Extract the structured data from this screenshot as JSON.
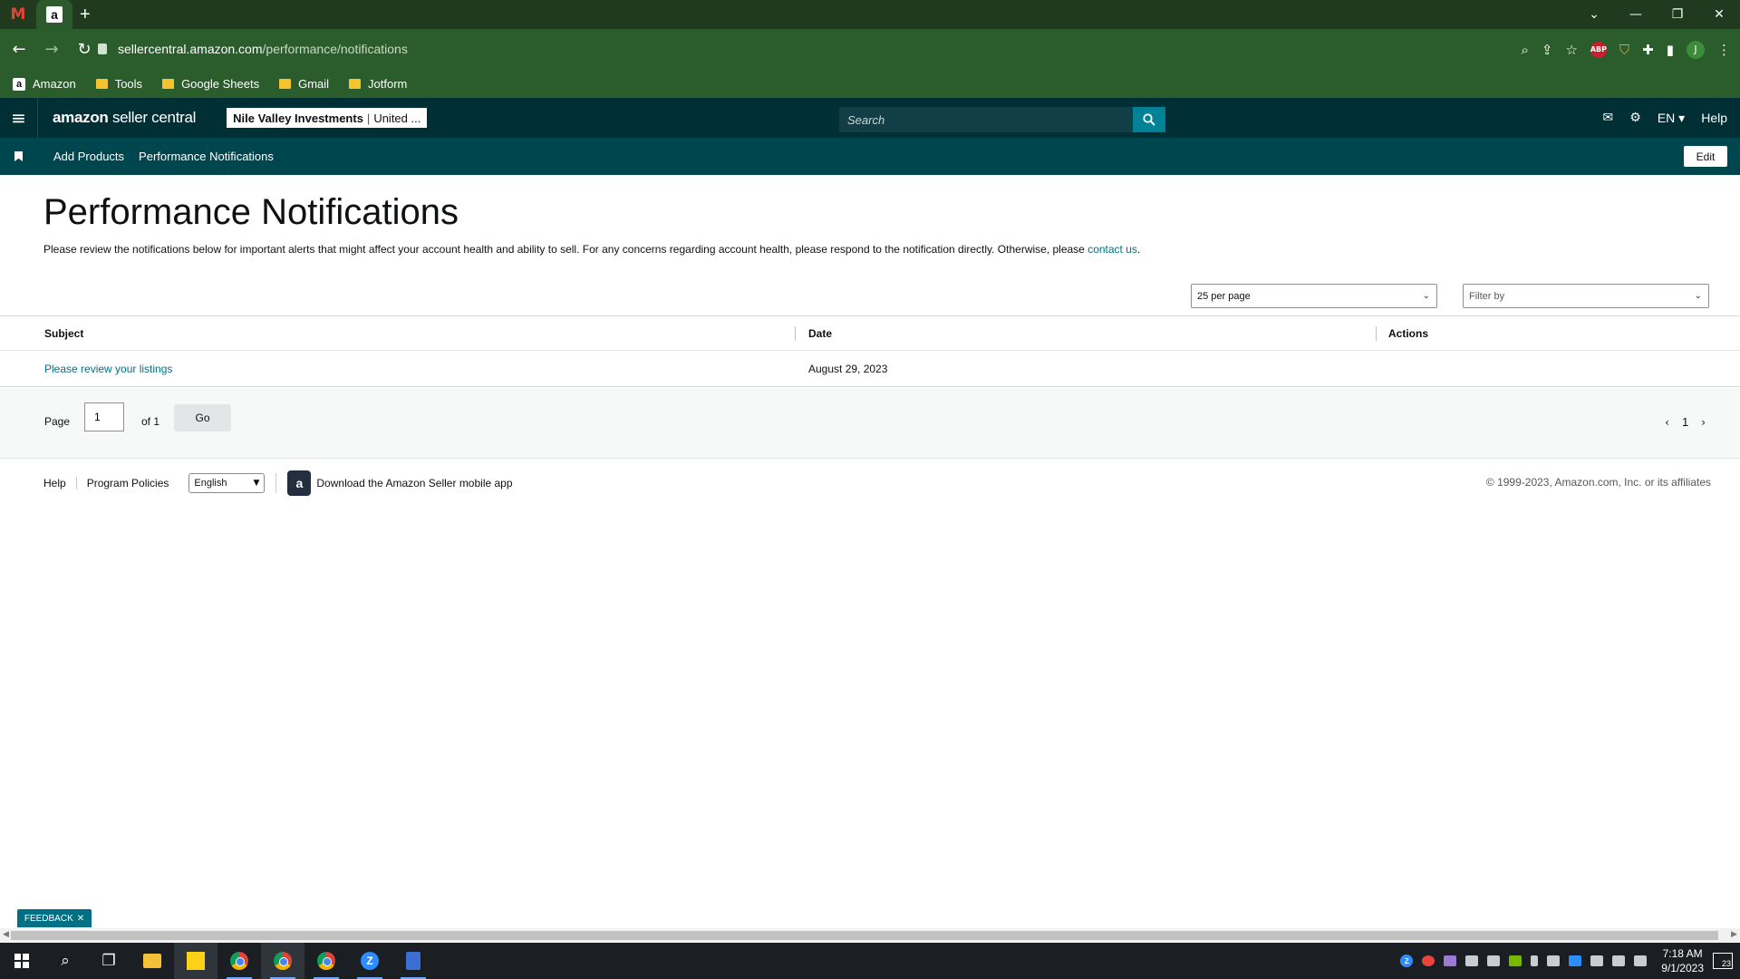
{
  "browser": {
    "url_host": "sellercentral.amazon.com",
    "url_path": "/performance/notifications",
    "bookmarks": [
      "Amazon",
      "Tools",
      "Google Sheets",
      "Gmail",
      "Jotform"
    ],
    "profile_initial": "J",
    "abp_label": "ABP"
  },
  "header": {
    "logo_brand": "amazon",
    "logo_product": "seller central",
    "account_name": "Nile Valley Investments",
    "account_market": "United ...",
    "search_placeholder": "Search",
    "language": "EN",
    "help": "Help"
  },
  "subnav": {
    "items": [
      "Add Products",
      "Performance Notifications"
    ],
    "edit_label": "Edit"
  },
  "page": {
    "title": "Performance Notifications",
    "intro": "Please review the notifications below for important alerts that might affect your account health and ability to sell. For any concerns regarding account health, please respond to the notification directly. Otherwise, please ",
    "contact_link": "contact us",
    "intro_end": "."
  },
  "controls": {
    "per_page": "25 per page",
    "filter_placeholder": "Filter by"
  },
  "table": {
    "columns": [
      "Subject",
      "Date",
      "Actions"
    ],
    "rows": [
      {
        "subject": "Please review your listings",
        "date": "August 29, 2023",
        "actions": ""
      }
    ]
  },
  "pagination": {
    "page_label": "Page",
    "page_value": "1",
    "of_label": "of 1",
    "go_label": "Go",
    "current_page": "1"
  },
  "footer": {
    "help": "Help",
    "program_policies": "Program Policies",
    "language": "English",
    "download_app": "Download the Amazon Seller mobile app",
    "copyright": "© 1999-2023, Amazon.com, Inc. or its affiliates"
  },
  "feedback": {
    "label": "FEEDBACK"
  },
  "taskbar": {
    "time": "7:18 AM",
    "date": "9/1/2023",
    "notifications": "23",
    "zoom_letter": "Z"
  },
  "colors": {
    "header_bg": "#002f36",
    "subnav_bg": "#00464f",
    "search_button": "#008296",
    "link": "#007185",
    "browser_green": "#2b5c2b"
  }
}
